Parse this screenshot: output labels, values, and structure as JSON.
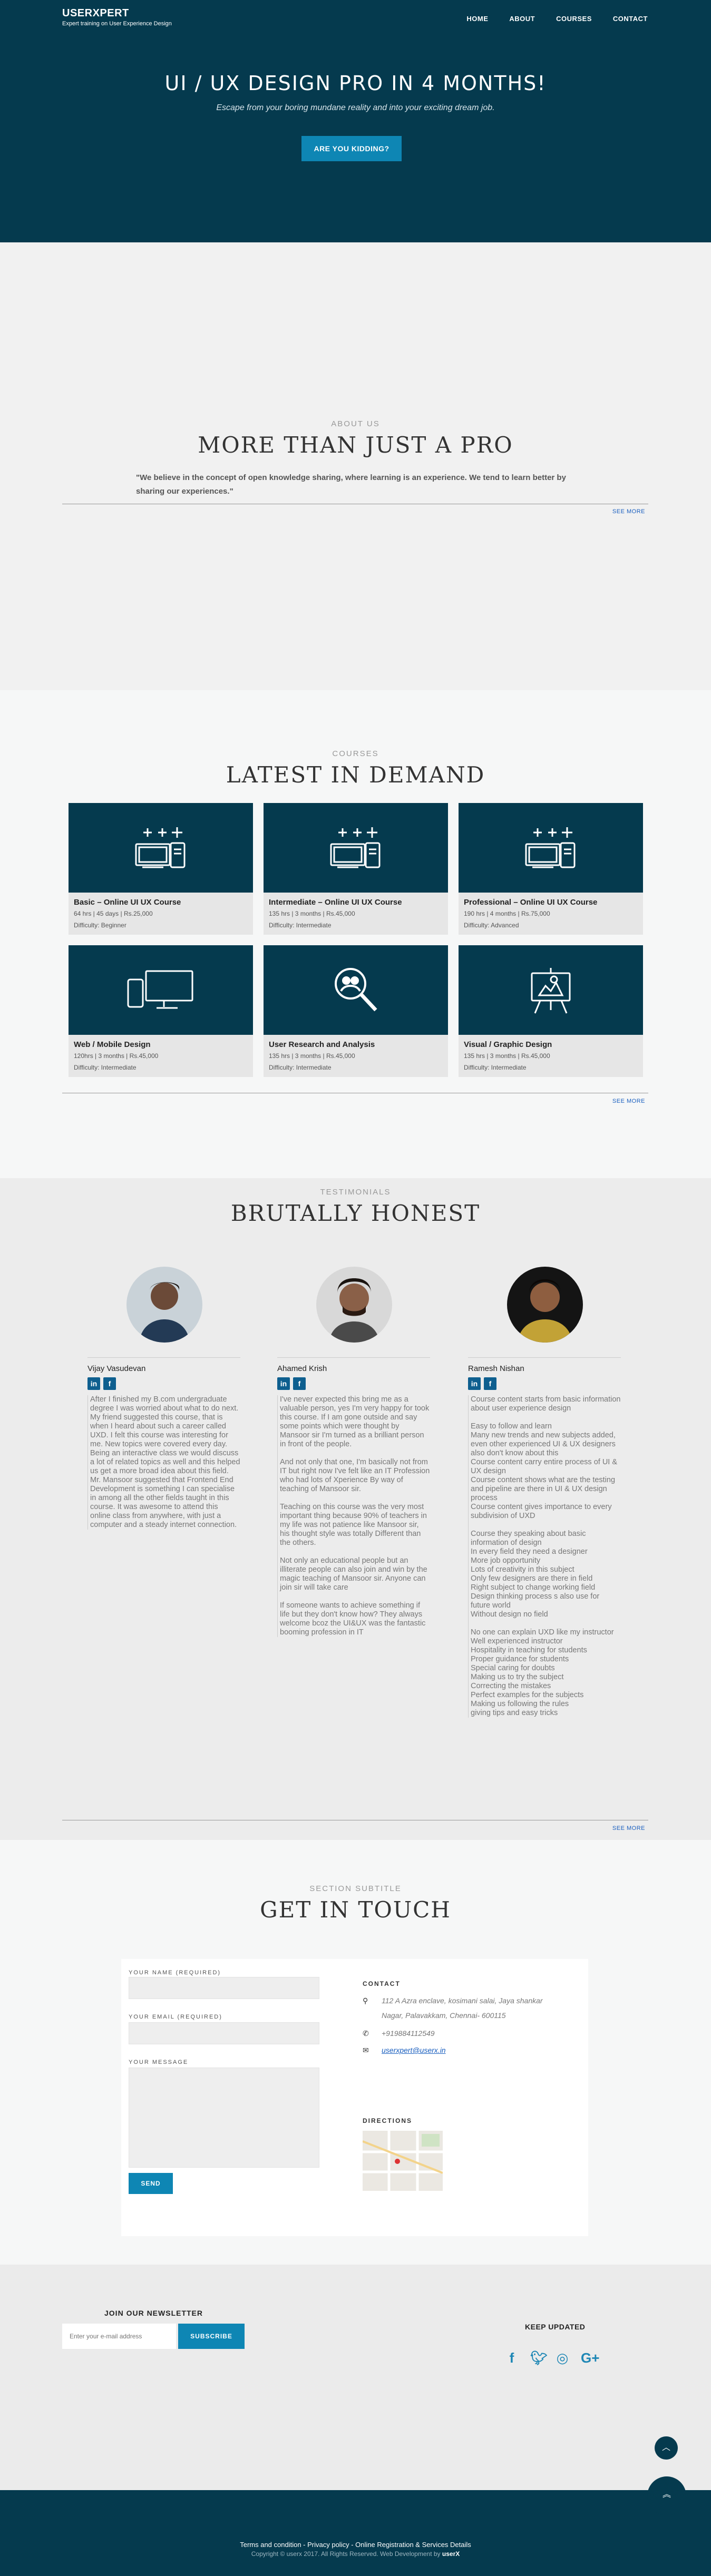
{
  "brand": {
    "name": "USERXPERT",
    "tagline": "Expert training on User Experience Design"
  },
  "nav": [
    "HOME",
    "ABOUT",
    "COURSES",
    "CONTACT"
  ],
  "hero": {
    "title": "UI / UX DESIGN PRO IN 4 MONTHS!",
    "subtitle": "Escape from your boring mundane reality and into your exciting dream job.",
    "button": "ARE YOU KIDDING?"
  },
  "about": {
    "subtitle": "ABOUT US",
    "title": "MORE THAN JUST A PRO",
    "quote": "\"We believe in the concept of open knowledge sharing, where learning is an experience. We tend to learn better by sharing our experiences.\"",
    "see_more": "SEE MORE"
  },
  "courses": {
    "subtitle": "COURSES",
    "title": "LATEST IN DEMAND",
    "see_more": "SEE MORE",
    "items": [
      {
        "title": "Basic – Online UI UX Course",
        "meta": "64 hrs | 45 days | Rs.25,000",
        "difficulty": "Difficulty: Beginner",
        "icon": "devices-plus-icon"
      },
      {
        "title": "Intermediate – Online UI UX Course",
        "meta": "135 hrs | 3 months | Rs.45,000",
        "difficulty": "Difficulty: Intermediate",
        "icon": "devices-plus-icon"
      },
      {
        "title": "Professional – Online UI UX Course",
        "meta": "190 hrs | 4 months | Rs.75,000",
        "difficulty": "Difficulty: Advanced",
        "icon": "devices-plus-icon"
      },
      {
        "title": "Web / Mobile Design",
        "meta": "120hrs | 3 months | Rs.45,000",
        "difficulty": "Difficulty: Intermediate",
        "icon": "responsive-devices-icon"
      },
      {
        "title": "User Research and Analysis",
        "meta": "135 hrs | 3 months | Rs.45,000",
        "difficulty": "Difficulty: Intermediate",
        "icon": "research-magnifier-icon"
      },
      {
        "title": "Visual / Graphic Design",
        "meta": "135 hrs | 3 months | Rs.45,000",
        "difficulty": "Difficulty: Intermediate",
        "icon": "graphic-easel-icon"
      }
    ]
  },
  "testimonials": {
    "subtitle": "TESTIMONIALS",
    "title": "BRUTALLY HONEST",
    "see_more": "SEE MORE",
    "items": [
      {
        "name": "Vijay Vasudevan",
        "text": "After I finished my B.com undergraduate degree I was worried about what to do next. My friend suggested this course, that is when I heard about such a career called UXD. I felt this course was interesting for me. New topics were covered every day. Being an interactive class we would discuss a lot of related topics as well and this helped us get a more broad idea about this field. Mr. Mansoor suggested that Frontend End Development is something I can specialise in among all the other fields taught in this course. It was awesome to attend this online class from anywhere, with just a computer and a steady internet connection."
      },
      {
        "name": "Ahamed Krish",
        "text": "I've never expected this bring me as a valuable person, yes I'm very happy for took this course. If I am gone outside and say some points which were thought by Mansoor sir I'm turned as a brilliant person in front of the people.\n\nAnd not only that one, I'm basically not from IT but right now I've felt like an IT Profession who had lots of Xperience By way of teaching of Mansoor sir.\n\nTeaching on this course was the very most important thing because 90% of teachers in my life was not patience like Mansoor sir, his thought style was totally Different than the others.\n\nNot only an educational people but an illiterate people can also join and win by the magic teaching of Mansoor sir. Anyone can join sir will take care\n\nIf someone wants to achieve something if life but they don't know how? They always welcome bcoz the UI&UX was the fantastic booming profession in IT"
      },
      {
        "name": "Ramesh Nishan",
        "text": "Course content starts from basic information about user experience design\n\nEasy to follow and learn\nMany new trends and new subjects added, even other experienced UI & UX designers also don't know about this\nCourse content carry entire process of UI & UX design\nCourse content shows what are the testing and pipeline are there in UI & UX design process\nCourse content gives importance to every subdivision of UXD\n\nCourse they speaking about basic information of design\nIn every field they need a designer\nMore job opportunity\nLots of creativity in this subject\nOnly few designers are there in field\nRight subject to change working field\nDesign thinking process s also use for future world\nWithout design no field\n\nNo one can explain UXD like my instructor\nWell experienced instructor\nHospitality in teaching for students\nProper guidance for students\nSpecial caring for doubts\nMaking us to try the subject\nCorrecting the mistakes\nPerfect examples for the subjects\nMaking us following the rules\ngiving tips and easy tricks"
      }
    ]
  },
  "contact": {
    "subtitle": "SECTION SUBTITLE",
    "title": "GET IN TOUCH",
    "name_label": "YOUR NAME (REQUIRED)",
    "email_label": "YOUR EMAIL (REQUIRED)",
    "message_label": "YOUR MESSAGE",
    "send": "SEND",
    "contact_head": "CONTACT",
    "address_1": "112 A Azra enclave, kosimani salai, Jaya shankar",
    "address_2": "Nagar, Palavakkam, Chennai- 600115",
    "phone": "+919884112549",
    "email": "userxpert@userx.in",
    "directions_head": "DIRECTIONS"
  },
  "newsletter": {
    "title": "JOIN OUR NEWSLETTER",
    "placeholder": "Enter your e-mail address",
    "button": "SUBSCRIBE",
    "keep_updated": "KEEP UPDATED"
  },
  "footer": {
    "links": "Terms and condition - Privacy policy - Online Registration & Services Details",
    "copyright": "Copyright © userx 2017. All Rights Reserved. Web Development by",
    "brand": "userX"
  },
  "colors": {
    "primary": "#053a4e",
    "accent": "#0e86b4",
    "link": "#1a5fbf"
  }
}
